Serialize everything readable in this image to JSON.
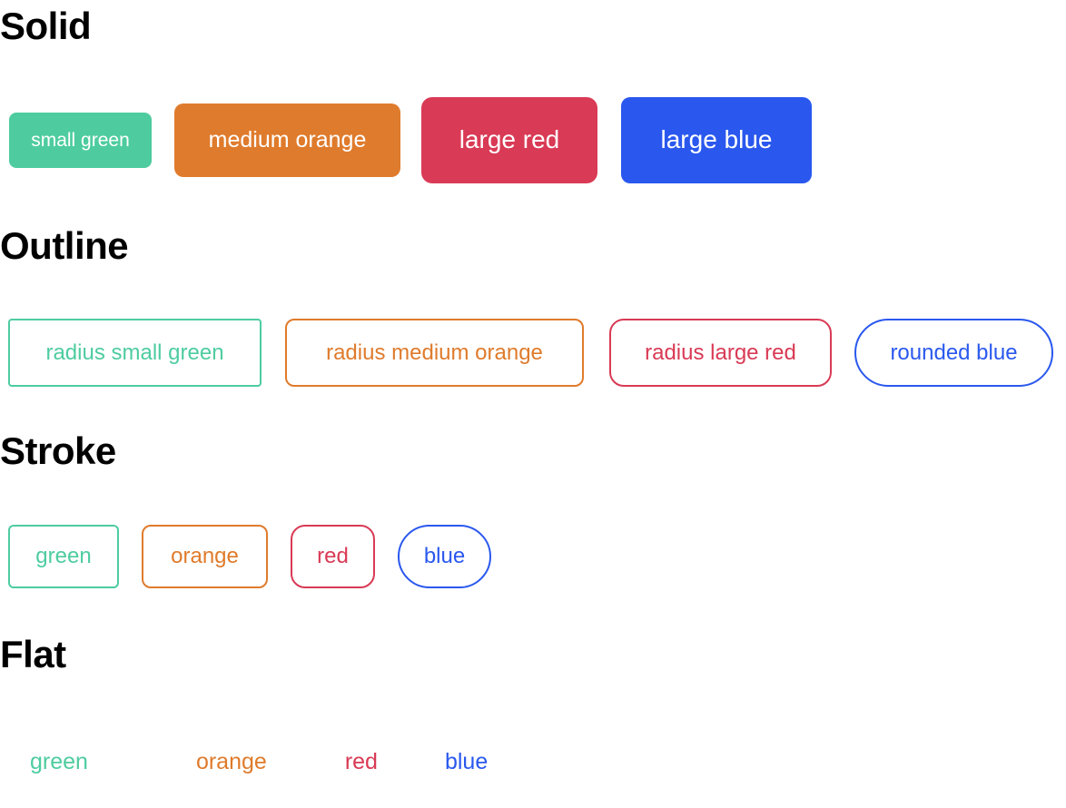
{
  "palette": {
    "green": "#4ECCA0",
    "orange": "#DF7B2C",
    "red": "#D93A55",
    "blue": "#2A58EE",
    "white": "#FFFFFF",
    "black": "#000000",
    "background": "#FFFFFF"
  },
  "sections": {
    "solid": {
      "heading": "Solid",
      "chips": [
        {
          "label": "small green",
          "fill": "#4ECCA0",
          "text": "#FFFFFF"
        },
        {
          "label": "medium orange",
          "fill": "#DF7B2C",
          "text": "#FFFFFF"
        },
        {
          "label": "large red",
          "fill": "#D93A55",
          "text": "#FFFFFF"
        },
        {
          "label": "large blue",
          "fill": "#2A58EE",
          "text": "#FFFFFF"
        }
      ]
    },
    "outline": {
      "heading": "Outline",
      "chips": [
        {
          "label": "radius small green",
          "border": "#4ECCA0",
          "text": "#4ECCA0"
        },
        {
          "label": "radius medium orange",
          "border": "#DF7B2C",
          "text": "#DF7B2C"
        },
        {
          "label": "radius large red",
          "border": "#D93A55",
          "text": "#D93A55"
        },
        {
          "label": "rounded blue",
          "border": "#2A58EE",
          "text": "#2A58EE"
        }
      ]
    },
    "stroke": {
      "heading": "Stroke",
      "chips": [
        {
          "label": "green",
          "border": "#4ECCA0",
          "text": "#4ECCA0"
        },
        {
          "label": "orange",
          "border": "#DF7B2C",
          "text": "#DF7B2C"
        },
        {
          "label": "red",
          "border": "#D93A55",
          "text": "#D93A55"
        },
        {
          "label": "blue",
          "border": "#2A58EE",
          "text": "#2A58EE"
        }
      ]
    },
    "flat": {
      "heading": "Flat",
      "chips": [
        {
          "label": "green",
          "text": "#4ECCA0"
        },
        {
          "label": "orange",
          "text": "#DF7B2C"
        },
        {
          "label": "red",
          "text": "#D93A55"
        },
        {
          "label": "blue",
          "text": "#2A58EE"
        }
      ]
    }
  }
}
